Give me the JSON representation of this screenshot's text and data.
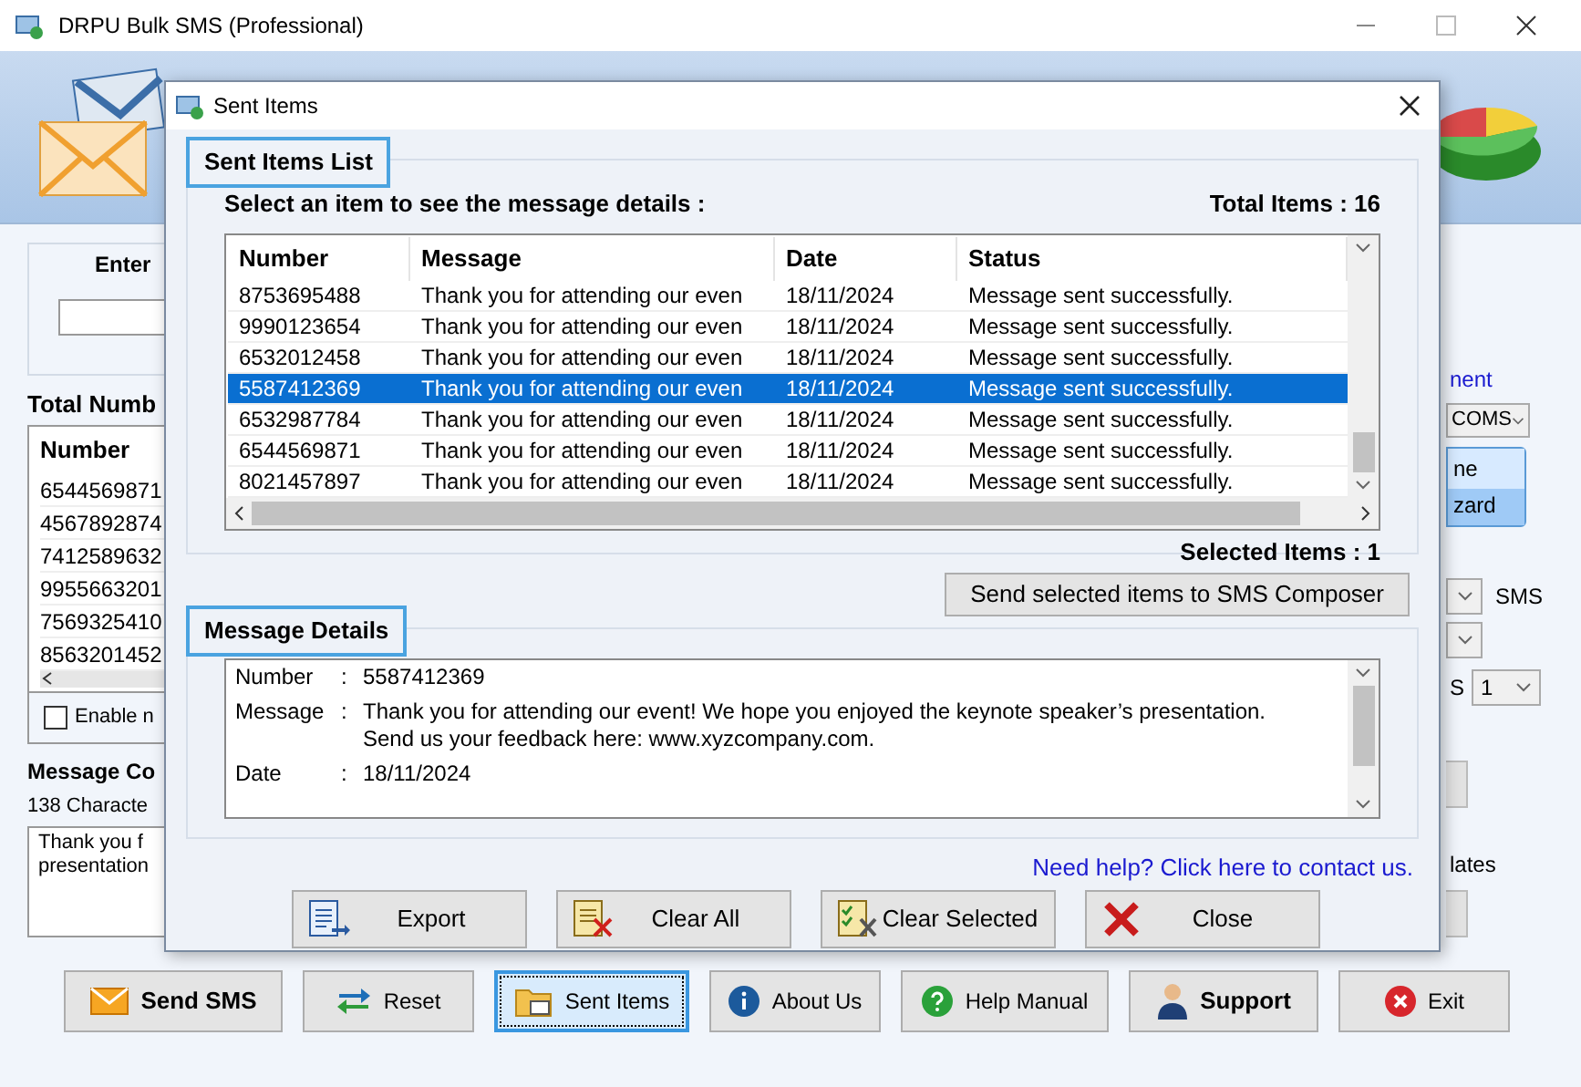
{
  "main_window": {
    "title": "DRPU Bulk SMS (Professional)"
  },
  "left_panel": {
    "group_label": "Enter",
    "total_label": "Total Numb",
    "table_header": "Number",
    "numbers": [
      "6544569871",
      "4567892874",
      "7412589632",
      "9955663201",
      "7569325410",
      "8563201452"
    ],
    "checkbox": {
      "label": "Enable n",
      "checked": false
    },
    "message_label": "Message Co",
    "char_count": "138 Characte",
    "message_lines": [
      "Thank you f",
      "presentation"
    ]
  },
  "right_panel": {
    "link": "nent",
    "port_select": "COMS",
    "wizard_lines": [
      "ne",
      "zard"
    ],
    "sms_label": "SMS",
    "s_label": "S",
    "count_select": "1",
    "templates_label": "lates"
  },
  "bottom_buttons": [
    {
      "label": "Send SMS",
      "kind": "envelope",
      "bold": true,
      "selected": false
    },
    {
      "label": "Reset",
      "kind": "arrows",
      "bold": false,
      "selected": false
    },
    {
      "label": "Sent Items",
      "kind": "folder",
      "bold": false,
      "selected": true
    },
    {
      "label": "About Us",
      "kind": "info",
      "bold": false,
      "selected": false
    },
    {
      "label": "Help Manual",
      "kind": "help",
      "bold": false,
      "selected": false
    },
    {
      "label": "Support",
      "kind": "person",
      "bold": true,
      "selected": false
    },
    {
      "label": "Exit",
      "kind": "exit",
      "bold": false,
      "selected": false
    }
  ],
  "dialog": {
    "title": "Sent Items",
    "list_section": {
      "label": "Sent Items List",
      "instruction": "Select an item to see the message details :",
      "total_items": "Total Items : 16",
      "columns": [
        "Number",
        "Message",
        "Date",
        "Status"
      ],
      "rows": [
        {
          "number": "8753695488",
          "message": "Thank you for attending our even",
          "date": "18/11/2024",
          "status": "Message sent successfully.",
          "selected": false
        },
        {
          "number": "9990123654",
          "message": "Thank you for attending our even",
          "date": "18/11/2024",
          "status": "Message sent successfully.",
          "selected": false
        },
        {
          "number": "6532012458",
          "message": "Thank you for attending our even",
          "date": "18/11/2024",
          "status": "Message sent successfully.",
          "selected": false
        },
        {
          "number": "5587412369",
          "message": "Thank you for attending our even",
          "date": "18/11/2024",
          "status": "Message sent successfully.",
          "selected": true
        },
        {
          "number": "6532987784",
          "message": "Thank you for attending our even",
          "date": "18/11/2024",
          "status": "Message sent successfully.",
          "selected": false
        },
        {
          "number": "6544569871",
          "message": "Thank you for attending our even",
          "date": "18/11/2024",
          "status": "Message sent successfully.",
          "selected": false
        },
        {
          "number": "8021457897",
          "message": "Thank you for attending our even",
          "date": "18/11/2024",
          "status": "Message sent successfully.",
          "selected": false
        }
      ],
      "selected_items": "Selected Items : 1"
    },
    "send_button": "Send selected items to SMS Composer",
    "details_section": {
      "label": "Message Details",
      "separator": ":",
      "lines": [
        {
          "label": "Number",
          "value": "5587412369"
        },
        {
          "label": "Message",
          "value": "Thank you for attending our event! We hope you enjoyed the keynote speaker’s presentation. Send us your feedback here: www.xyzcompany.com."
        },
        {
          "label": "Date",
          "value": "18/11/2024"
        }
      ]
    },
    "help_link": "Need help? Click here to contact us.",
    "buttons": [
      {
        "label": "Export",
        "kind": "export"
      },
      {
        "label": "Clear All",
        "kind": "clear_all"
      },
      {
        "label": "Clear Selected",
        "kind": "clear_selected"
      },
      {
        "label": "Close",
        "kind": "close"
      }
    ]
  }
}
